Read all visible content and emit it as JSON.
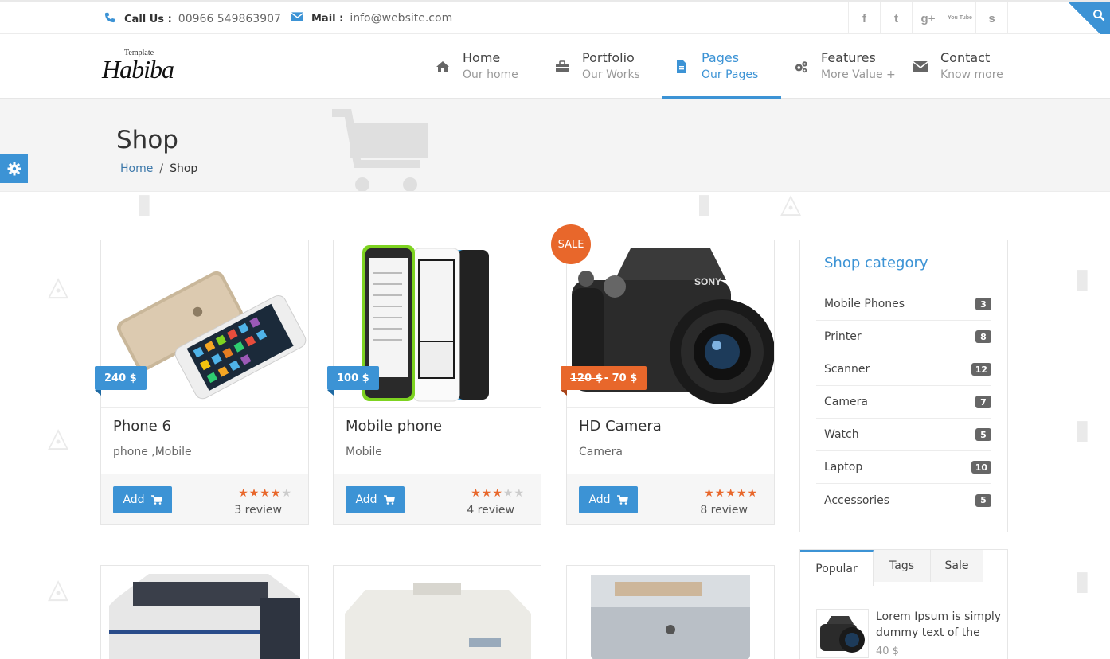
{
  "topbar": {
    "call_label": "Call Us :",
    "call_value": "00966 549863907",
    "mail_label": "Mail :",
    "mail_value": "info@website.com",
    "socials": [
      "f",
      "t",
      "g+",
      "You Tube",
      "s"
    ]
  },
  "logo": {
    "small": "Template",
    "big": "Habiba"
  },
  "nav": [
    {
      "title": "Home",
      "sub": "Our home",
      "icon": "home-icon"
    },
    {
      "title": "Portfolio",
      "sub": "Our Works",
      "icon": "briefcase-icon"
    },
    {
      "title": "Pages",
      "sub": "Our Pages",
      "icon": "document-icon",
      "active": true
    },
    {
      "title": "Features",
      "sub": "More Value +",
      "icon": "gears-icon"
    },
    {
      "title": "Contact",
      "sub": "Know more",
      "icon": "envelope-icon"
    }
  ],
  "page": {
    "title": "Shop",
    "breadcrumb": {
      "home": "Home",
      "sep": "/",
      "current": "Shop"
    }
  },
  "products": [
    {
      "name": "Phone 6",
      "category": "phone ,Mobile",
      "price": "240 $",
      "rating": 4,
      "reviews": "3 review",
      "add_label": "Add"
    },
    {
      "name": "Mobile phone",
      "category": "Mobile",
      "price": "100 $",
      "rating": 3,
      "reviews": "4 review",
      "add_label": "Add"
    },
    {
      "name": "HD Camera",
      "category": "Camera",
      "old_price": "120 $",
      "price": "- 70 $",
      "rating": 5,
      "reviews": "8 review",
      "add_label": "Add",
      "sale_label": "SALE"
    }
  ],
  "sidebar": {
    "category_title": "Shop category",
    "categories": [
      {
        "name": "Mobile Phones",
        "count": "3"
      },
      {
        "name": "Printer",
        "count": "8"
      },
      {
        "name": "Scanner",
        "count": "12"
      },
      {
        "name": "Camera",
        "count": "7"
      },
      {
        "name": "Watch",
        "count": "5"
      },
      {
        "name": "Laptop",
        "count": "10"
      },
      {
        "name": "Accessories",
        "count": "5"
      }
    ],
    "tabs": [
      "Popular",
      "Tags",
      "Sale"
    ],
    "popular": {
      "title": "Lorem Ipsum is simply dummy text of the",
      "price": "40 $"
    }
  },
  "colors": {
    "accent": "#3c93d5",
    "sale": "#e8672b"
  }
}
